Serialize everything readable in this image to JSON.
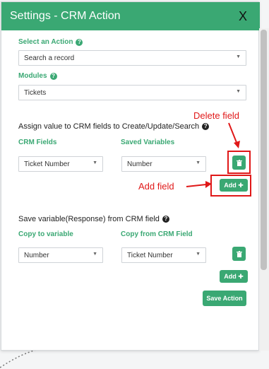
{
  "dialog": {
    "title": "Settings - CRM Action",
    "close_label": "X"
  },
  "action": {
    "label": "Select an Action",
    "value": "Search a record"
  },
  "modules": {
    "label": "Modules",
    "value": "Tickets"
  },
  "assign_section": {
    "title": "Assign value to CRM fields to Create/Update/Search",
    "col1_label": "CRM Fields",
    "col2_label": "Saved Variables",
    "row": {
      "crm_field": "Ticket Number",
      "saved_variable": "Number"
    },
    "add_label": "Add"
  },
  "save_section": {
    "title": "Save variable(Response) from CRM field",
    "col1_label": "Copy to variable",
    "col2_label": "Copy from CRM Field",
    "row": {
      "copy_to": "Number",
      "copy_from": "Ticket Number"
    },
    "add_label": "Add"
  },
  "save_action_label": "Save Action",
  "annotations": {
    "delete_field": "Delete field",
    "add_field": "Add field"
  },
  "colors": {
    "accent": "#3aa873",
    "annotation": "#e01818"
  }
}
